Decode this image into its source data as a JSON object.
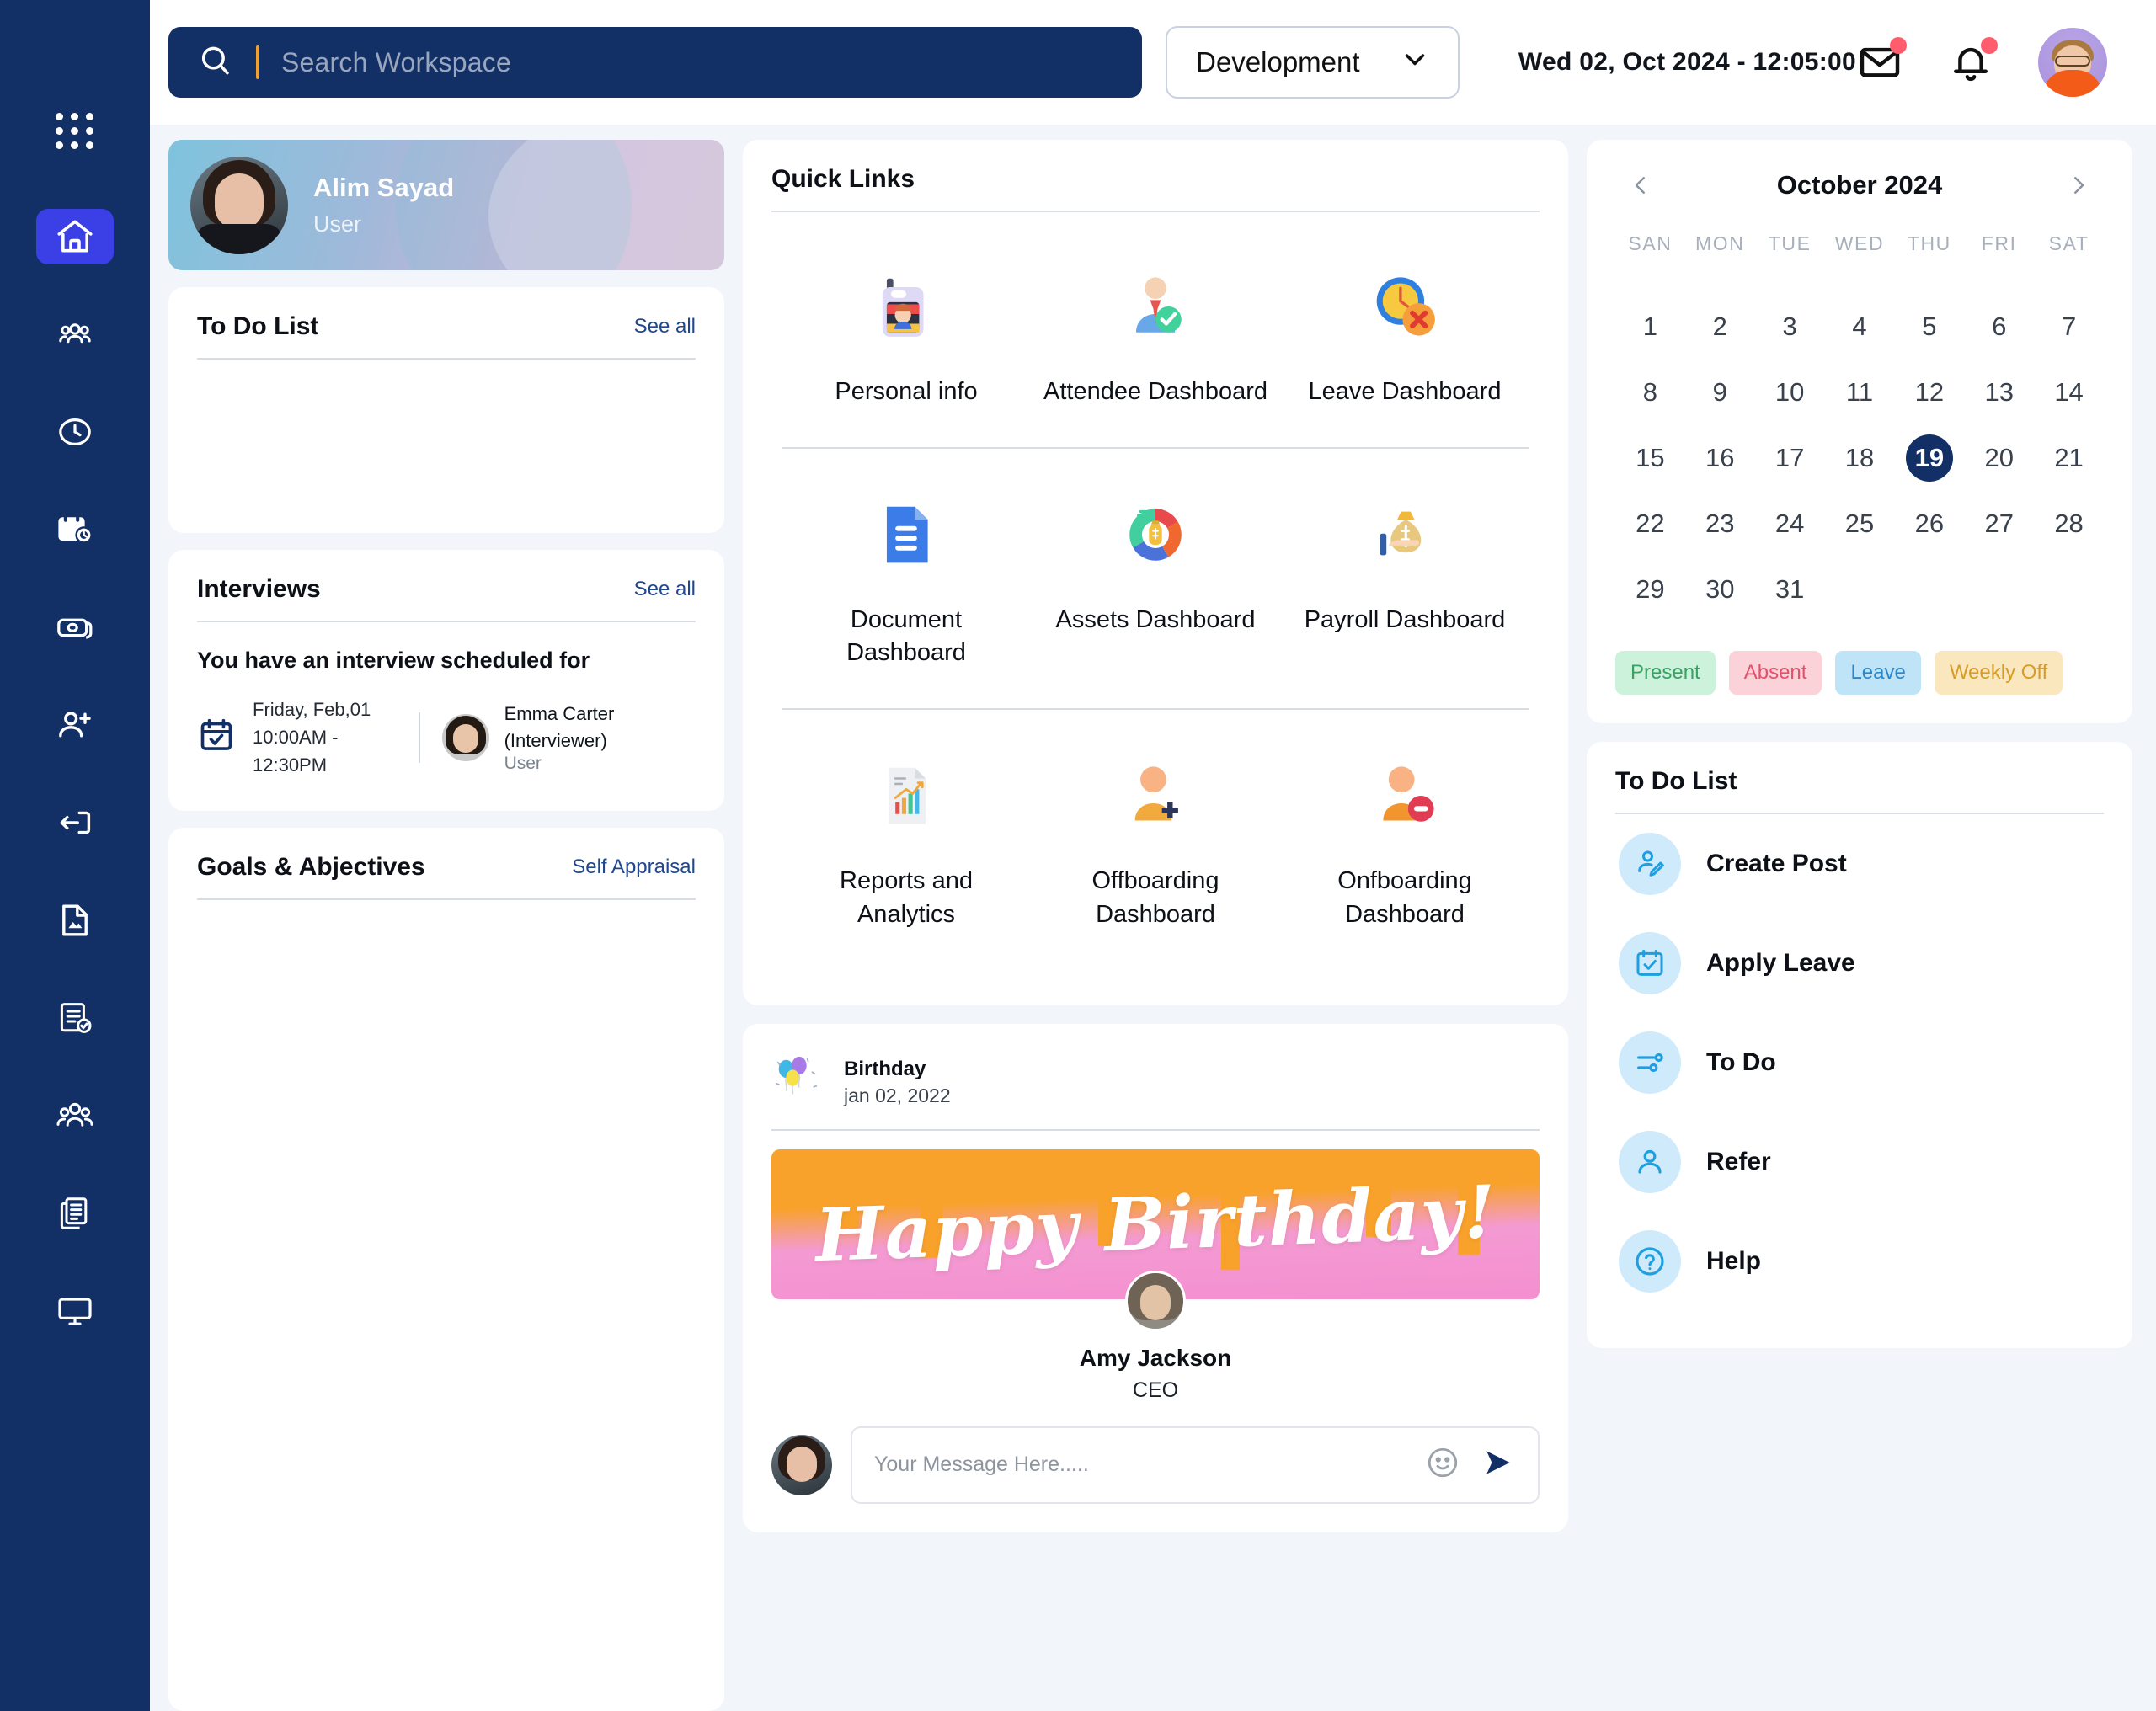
{
  "sidebar": {
    "items": [
      {
        "icon": "apps-grid-icon",
        "name": "apps-grid",
        "active": false
      },
      {
        "icon": "home-icon",
        "name": "home",
        "active": true
      },
      {
        "icon": "team-icon",
        "name": "team",
        "active": false
      },
      {
        "icon": "clock-icon",
        "name": "attendance",
        "active": false
      },
      {
        "icon": "calendar-clock-icon",
        "name": "timesheet",
        "active": false
      },
      {
        "icon": "money-icon",
        "name": "payroll",
        "active": false
      },
      {
        "icon": "user-add-icon",
        "name": "recruitment",
        "active": false
      },
      {
        "icon": "logout-icon",
        "name": "exit",
        "active": false
      },
      {
        "icon": "file-image-icon",
        "name": "documents",
        "active": false
      },
      {
        "icon": "checklist-icon",
        "name": "tasks",
        "active": false
      },
      {
        "icon": "people-group-icon",
        "name": "employees",
        "active": false
      },
      {
        "icon": "documents-stack-icon",
        "name": "reports",
        "active": false
      },
      {
        "icon": "monitor-icon",
        "name": "assets",
        "active": false
      }
    ]
  },
  "header": {
    "search_placeholder": "Search Workspace",
    "search_value": "",
    "search_icon": "search-icon",
    "department": "Development",
    "department_options": [
      "Development"
    ],
    "chevron_icon": "chevron-down-icon",
    "datetime": "Wed 02, Oct 2024 - 12:05:00",
    "mail_icon": "mail-icon",
    "bell_icon": "bell-icon",
    "mail_has_badge": true,
    "bell_has_badge": true,
    "avatar_name": "user-avatar"
  },
  "profile": {
    "name": "Alim Sayad",
    "role": "User"
  },
  "todo_left": {
    "title": "To Do List",
    "see_all": "See all",
    "items": []
  },
  "interviews": {
    "title": "Interviews",
    "see_all": "See all",
    "scheduled_text": "You have an interview scheduled for",
    "date": "Friday, Feb,01",
    "time": "10:00AM - 12:30PM",
    "interviewer_name": "Emma Carter (Interviewer)",
    "interviewer_role": "User",
    "calendar_icon": "calendar-check-icon"
  },
  "goals": {
    "title": "Goals & Abjectives",
    "action": "Self Appraisal",
    "items": []
  },
  "quick_links": {
    "title": "Quick Links",
    "rows": [
      [
        {
          "label": "Personal info",
          "icon": "id-badge-icon"
        },
        {
          "label": "Attendee Dashboard",
          "icon": "employee-check-icon"
        },
        {
          "label": "Leave Dashboard",
          "icon": "clock-cross-icon"
        }
      ],
      [
        {
          "label": "Document Dashboard",
          "icon": "document-blue-icon"
        },
        {
          "label": "Assets Dashboard",
          "icon": "donut-money-icon"
        },
        {
          "label": "Payroll Dashboard",
          "icon": "money-bag-hand-icon"
        }
      ],
      [
        {
          "label": "Reports and Analytics",
          "icon": "report-chart-icon"
        },
        {
          "label": "Offboarding Dashboard",
          "icon": "user-plus-orange-icon"
        },
        {
          "label": "Onfboarding Dashboard",
          "icon": "user-minus-orange-icon"
        }
      ]
    ]
  },
  "birthday": {
    "label": "Birthday",
    "date": "jan 02, 2022",
    "balloons_icon": "balloons-icon",
    "banner_text": "Happy Birthday!",
    "person_name": "Amy Jackson",
    "person_role": "CEO",
    "message_placeholder": "Your Message Here.....",
    "message_value": "",
    "emoji_icon": "emoji-icon",
    "send_icon": "send-icon"
  },
  "calendar": {
    "title": "October 2024",
    "prev_icon": "chevron-left-icon",
    "next_icon": "chevron-right-icon",
    "day_headers": [
      "SAN",
      "MON",
      "TUE",
      "WED",
      "THU",
      "FRI",
      "SAT"
    ],
    "leading_blanks": 0,
    "days": [
      1,
      2,
      3,
      4,
      5,
      6,
      7,
      8,
      9,
      10,
      11,
      12,
      13,
      14,
      15,
      16,
      17,
      18,
      19,
      20,
      21,
      22,
      23,
      24,
      25,
      26,
      27,
      28,
      29,
      30,
      31
    ],
    "selected_day": 19,
    "legend": [
      {
        "label": "Present",
        "bg": "#cdf2dc",
        "fg": "#3aa163"
      },
      {
        "label": "Absent",
        "bg": "#fbd2d8",
        "fg": "#e2516c"
      },
      {
        "label": "Leave",
        "bg": "#bfe3f7",
        "fg": "#2b87c9"
      },
      {
        "label": "Weekly Off",
        "bg": "#fbe7bd",
        "fg": "#d79c27"
      }
    ]
  },
  "todo_right": {
    "title": "To Do List",
    "items": [
      {
        "label": "Create Post",
        "icon": "create-post-icon"
      },
      {
        "label": "Apply Leave",
        "icon": "apply-leave-icon"
      },
      {
        "label": "To Do",
        "icon": "todo-sliders-icon"
      },
      {
        "label": "Refer",
        "icon": "refer-user-icon"
      },
      {
        "label": "Help",
        "icon": "help-question-icon"
      }
    ]
  },
  "colors": {
    "sidebar": "#123066",
    "sidebar_active": "#3b3fe6",
    "accent_blue": "#20478f",
    "page_bg": "#f2f5f9",
    "search_caret": "#f0a033",
    "badge_red": "#ff5d6e"
  }
}
